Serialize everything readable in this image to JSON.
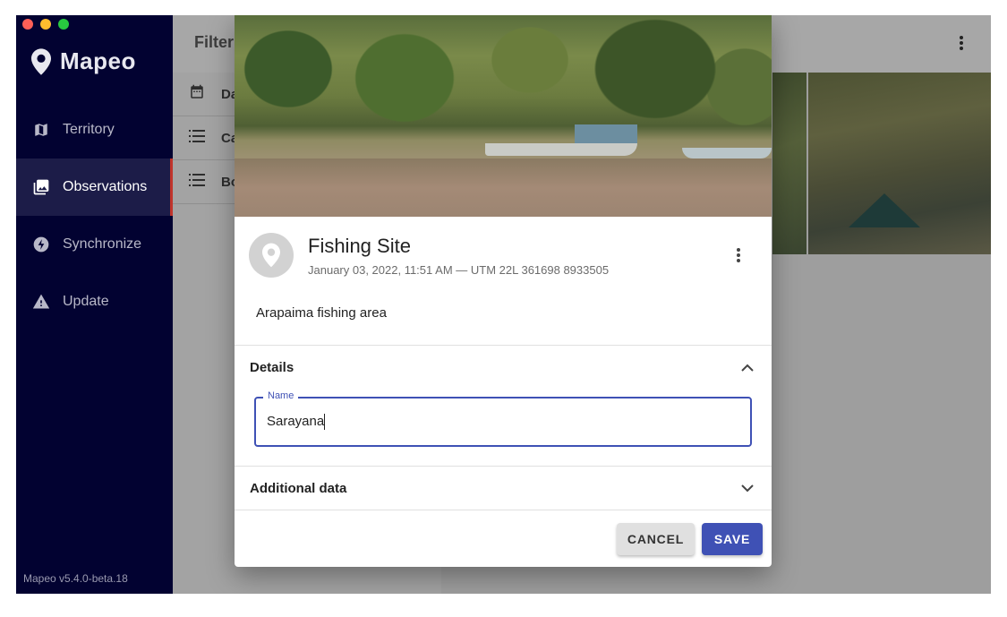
{
  "window": {
    "traffic_lights": [
      "close",
      "minimize",
      "maximize"
    ]
  },
  "sidebar": {
    "brand": "Mapeo",
    "items": [
      {
        "label": "Territory",
        "icon": "map-icon"
      },
      {
        "label": "Observations",
        "icon": "photo-library-icon",
        "active": true
      },
      {
        "label": "Synchronize",
        "icon": "lightning-icon"
      },
      {
        "label": "Update",
        "icon": "warning-icon"
      }
    ],
    "version": "Mapeo v5.4.0-beta.18"
  },
  "background": {
    "filter_title": "Filter",
    "filters": [
      {
        "label": "Da",
        "icon": "calendar-icon"
      },
      {
        "label": "Ca",
        "icon": "list-icon"
      },
      {
        "label": "Bo",
        "icon": "list-icon"
      }
    ]
  },
  "modal": {
    "title": "Fishing Site",
    "meta": "January 03, 2022, 11:51 AM — UTM 22L 361698 8933505",
    "description": "Arapaima fishing area",
    "details": {
      "heading": "Details",
      "name_label": "Name",
      "name_value": "Sarayana"
    },
    "additional": {
      "heading": "Additional data"
    },
    "cancel_label": "CANCEL",
    "save_label": "SAVE"
  },
  "colors": {
    "primary": "#3f51b5",
    "sidebar_bg": "#020231",
    "active_indicator": "#c0342b"
  }
}
